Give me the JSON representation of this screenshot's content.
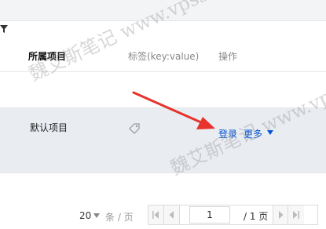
{
  "table": {
    "columns": {
      "project": "所属项目",
      "tags": "标签(key:value)",
      "operations": "操作"
    },
    "rows": [
      {
        "project": "默认项目",
        "actions": {
          "login": "登录",
          "more": "更多"
        }
      }
    ]
  },
  "pagination": {
    "page_size": "20",
    "per_page_suffix": "条 / 页",
    "current_page": "1",
    "total_pages": "/ 1 页"
  },
  "watermark": {
    "line1": "魏艾斯笔记 www.vpsss.net",
    "line2": "魏艾斯笔记 www.vpsss.net"
  },
  "colors": {
    "link": "#0052d9",
    "arrow": "#e8322c",
    "row_highlight": "#e9ecf1"
  }
}
